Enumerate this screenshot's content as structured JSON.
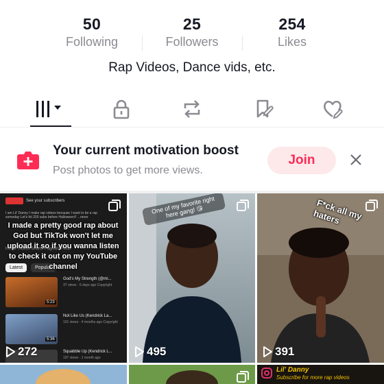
{
  "stats": {
    "following": {
      "value": "50",
      "label": "Following"
    },
    "followers": {
      "value": "25",
      "label": "Followers"
    },
    "likes": {
      "value": "254",
      "label": "Likes"
    }
  },
  "bio": "Rap Videos, Dance vids, etc.",
  "tabs": [
    {
      "icon": "videos-grid-icon",
      "active": true
    },
    {
      "icon": "lock-icon"
    },
    {
      "icon": "repost-icon"
    },
    {
      "icon": "favorites-icon"
    },
    {
      "icon": "liked-heart-icon"
    }
  ],
  "promo": {
    "title": "Your current motivation boost",
    "subtitle": "Post photos to get more views.",
    "join_label": "Join",
    "accent": "#fe2c55"
  },
  "videos": [
    {
      "views": "272",
      "overlay": "I made a pretty good rap about God but TikTok won't let me upload it so if you wanna listen to check it out on my YouTube channel",
      "yt_header": "See your subscribers",
      "yt_desc": "I am Lil' Danny I make rap videos because I want to be a rap someday Let's hit 200 subs before Halloween!! ...more",
      "yt_tabs": "Home   Videos   Shorts   Playlists   Posts",
      "chips": [
        "Latest",
        "Popular"
      ],
      "rows": [
        {
          "title": "God's My Strength (@mi...",
          "meta": "37 views · 6 days ago\nCopyright",
          "duration": "5:23"
        },
        {
          "title": "Not Like Us (Kendrick La...",
          "meta": "101 views · 4 months ago\nCopyright",
          "duration": "5:36"
        },
        {
          "title": "Squabble Up (Kendrick L...",
          "meta": "197 views · 1 month ago",
          "duration": ""
        }
      ]
    },
    {
      "views": "495",
      "overlay": "One of my favorite right here gang! 😘"
    },
    {
      "views": "391",
      "overlay": "F*ck all my haters"
    },
    {
      "views": "",
      "overlay": ""
    },
    {
      "views": "",
      "overlay": ""
    },
    {
      "views": "",
      "overlay": "Lil' Danny",
      "subtitle": "Subscribe for more rap videos"
    }
  ]
}
